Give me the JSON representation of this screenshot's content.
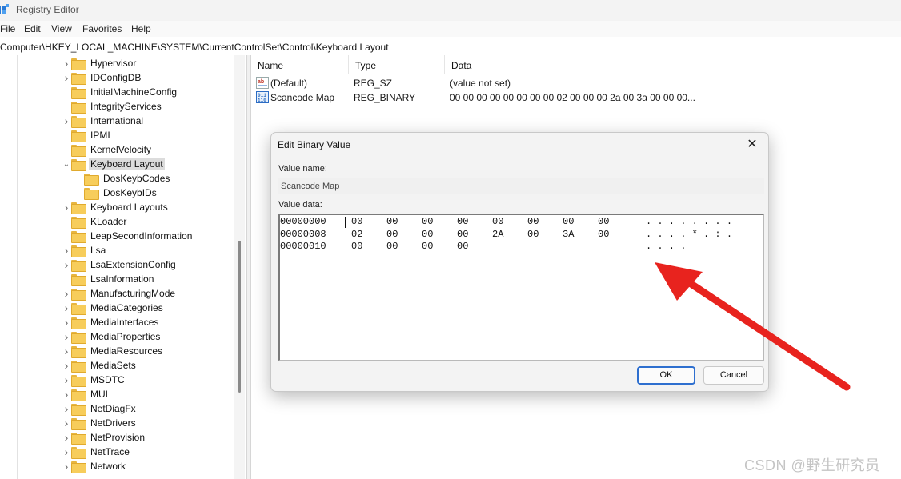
{
  "window": {
    "title": "Registry Editor"
  },
  "menu": [
    "File",
    "Edit",
    "View",
    "Favorites",
    "Help"
  ],
  "address": "Computer\\HKEY_LOCAL_MACHINE\\SYSTEM\\CurrentControlSet\\Control\\Keyboard Layout",
  "tree": {
    "items": [
      {
        "label": "Hypervisor",
        "depth": 0,
        "expander": ">"
      },
      {
        "label": "IDConfigDB",
        "depth": 0,
        "expander": ">"
      },
      {
        "label": "InitialMachineConfig",
        "depth": 0,
        "expander": ""
      },
      {
        "label": "IntegrityServices",
        "depth": 0,
        "expander": ""
      },
      {
        "label": "International",
        "depth": 0,
        "expander": ">"
      },
      {
        "label": "IPMI",
        "depth": 0,
        "expander": ""
      },
      {
        "label": "KernelVelocity",
        "depth": 0,
        "expander": ""
      },
      {
        "label": "Keyboard Layout",
        "depth": 0,
        "expander": "v",
        "selected": true
      },
      {
        "label": "DosKeybCodes",
        "depth": 1,
        "expander": ""
      },
      {
        "label": "DosKeybIDs",
        "depth": 1,
        "expander": ""
      },
      {
        "label": "Keyboard Layouts",
        "depth": 0,
        "expander": ">"
      },
      {
        "label": "KLoader",
        "depth": 0,
        "expander": ""
      },
      {
        "label": "LeapSecondInformation",
        "depth": 0,
        "expander": ""
      },
      {
        "label": "Lsa",
        "depth": 0,
        "expander": ">"
      },
      {
        "label": "LsaExtensionConfig",
        "depth": 0,
        "expander": ">"
      },
      {
        "label": "LsaInformation",
        "depth": 0,
        "expander": ""
      },
      {
        "label": "ManufacturingMode",
        "depth": 0,
        "expander": ">"
      },
      {
        "label": "MediaCategories",
        "depth": 0,
        "expander": ">"
      },
      {
        "label": "MediaInterfaces",
        "depth": 0,
        "expander": ">"
      },
      {
        "label": "MediaProperties",
        "depth": 0,
        "expander": ">"
      },
      {
        "label": "MediaResources",
        "depth": 0,
        "expander": ">"
      },
      {
        "label": "MediaSets",
        "depth": 0,
        "expander": ">"
      },
      {
        "label": "MSDTC",
        "depth": 0,
        "expander": ">"
      },
      {
        "label": "MUI",
        "depth": 0,
        "expander": ">"
      },
      {
        "label": "NetDiagFx",
        "depth": 0,
        "expander": ">"
      },
      {
        "label": "NetDrivers",
        "depth": 0,
        "expander": ">"
      },
      {
        "label": "NetProvision",
        "depth": 0,
        "expander": ">"
      },
      {
        "label": "NetTrace",
        "depth": 0,
        "expander": ">"
      },
      {
        "label": "Network",
        "depth": 0,
        "expander": ">"
      }
    ]
  },
  "list": {
    "columns": [
      "Name",
      "Type",
      "Data"
    ],
    "rows": [
      {
        "icon": "string-value-icon",
        "name": "(Default)",
        "type": "REG_SZ",
        "data": "(value not set)"
      },
      {
        "icon": "binary-value-icon",
        "name": "Scancode Map",
        "type": "REG_BINARY",
        "data": "00 00 00 00 00 00 00 00 02 00 00 00 2a 00 3a 00 00 00..."
      }
    ]
  },
  "dialog": {
    "title": "Edit Binary Value",
    "value_name_label": "Value name:",
    "value_name": "Scancode Map",
    "value_data_label": "Value data:",
    "hex_rows": [
      {
        "offset": "00000000",
        "bytes": [
          "00",
          "00",
          "00",
          "00",
          "00",
          "00",
          "00",
          "00"
        ],
        "ascii": ". . . . . . . ."
      },
      {
        "offset": "00000008",
        "bytes": [
          "02",
          "00",
          "00",
          "00",
          "2A",
          "00",
          "3A",
          "00"
        ],
        "ascii": ". . . . * . : ."
      },
      {
        "offset": "00000010",
        "bytes": [
          "00",
          "00",
          "00",
          "00"
        ],
        "ascii": ". . . ."
      }
    ],
    "ok_label": "OK",
    "cancel_label": "Cancel"
  },
  "annotation": {
    "color": "#e8231e"
  },
  "watermark": "CSDN @野生研究员"
}
